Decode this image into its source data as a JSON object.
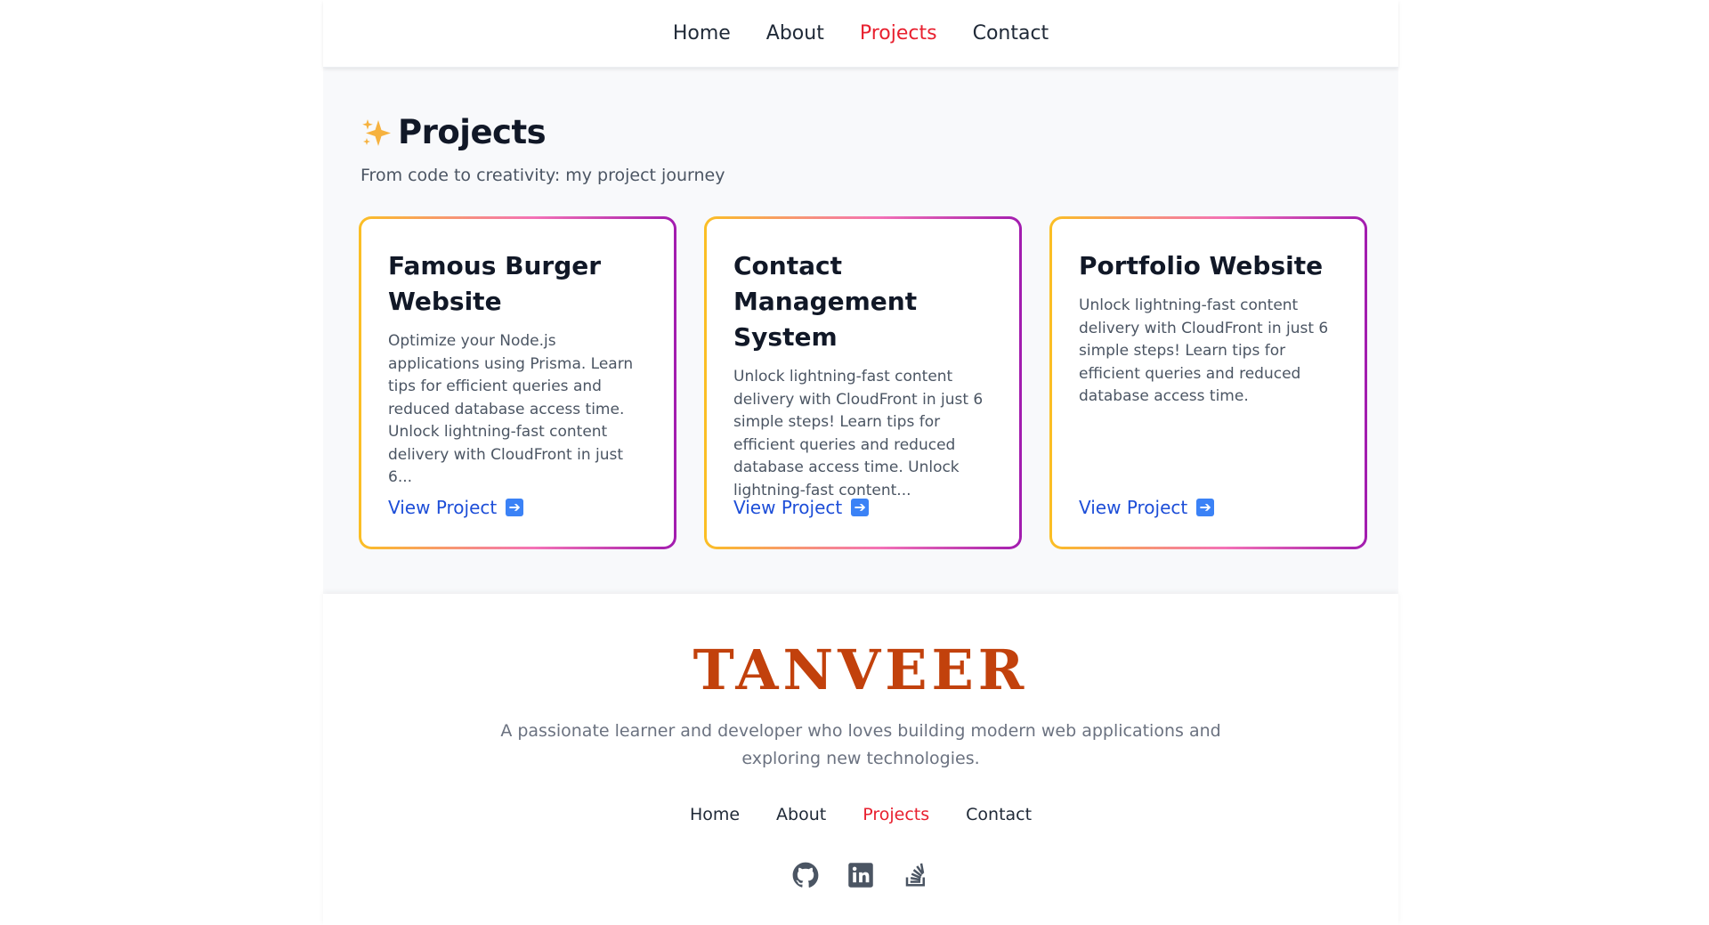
{
  "nav": {
    "items": [
      {
        "label": "Home"
      },
      {
        "label": "About"
      },
      {
        "label": "Projects"
      },
      {
        "label": "Contact"
      }
    ],
    "active": "Projects"
  },
  "projects": {
    "title": "Projects",
    "title_icon": "sparkles-icon",
    "subtitle": "From code to creativity: my project journey",
    "cards": [
      {
        "title": "Famous Burger Website",
        "description": "Optimize your Node.js applications using Prisma. Learn tips for efficient queries and reduced database access time. Unlock lightning-fast content delivery with CloudFront in just 6...",
        "link_label": "View Project",
        "link_icon": "arrow-right-icon"
      },
      {
        "title": "Contact Management System",
        "description": "Unlock lightning-fast content delivery with CloudFront in just 6 simple steps! Learn tips for efficient queries and reduced database access time. Unlock lightning-fast content...",
        "link_label": "View Project",
        "link_icon": "arrow-right-icon"
      },
      {
        "title": "Portfolio Website",
        "description": "Unlock lightning-fast content delivery with CloudFront in just 6 simple steps! Learn tips for efficient queries and reduced database access time.",
        "link_label": "View Project",
        "link_icon": "arrow-right-icon"
      }
    ]
  },
  "footer": {
    "brand": "TANVEER",
    "tagline": "A passionate learner and developer who loves building modern web applications and exploring new technologies.",
    "nav": [
      {
        "label": "Home"
      },
      {
        "label": "About"
      },
      {
        "label": "Projects"
      },
      {
        "label": "Contact"
      }
    ],
    "socials": [
      "github-icon",
      "linkedin-icon",
      "stackoverflow-icon"
    ]
  },
  "colors": {
    "accent_active": "#e8202f",
    "link_blue": "#1d4ed8",
    "brand": "#c2410c",
    "card_gradient": [
      "#fbbf24",
      "#f472b6",
      "#a21caf"
    ]
  }
}
